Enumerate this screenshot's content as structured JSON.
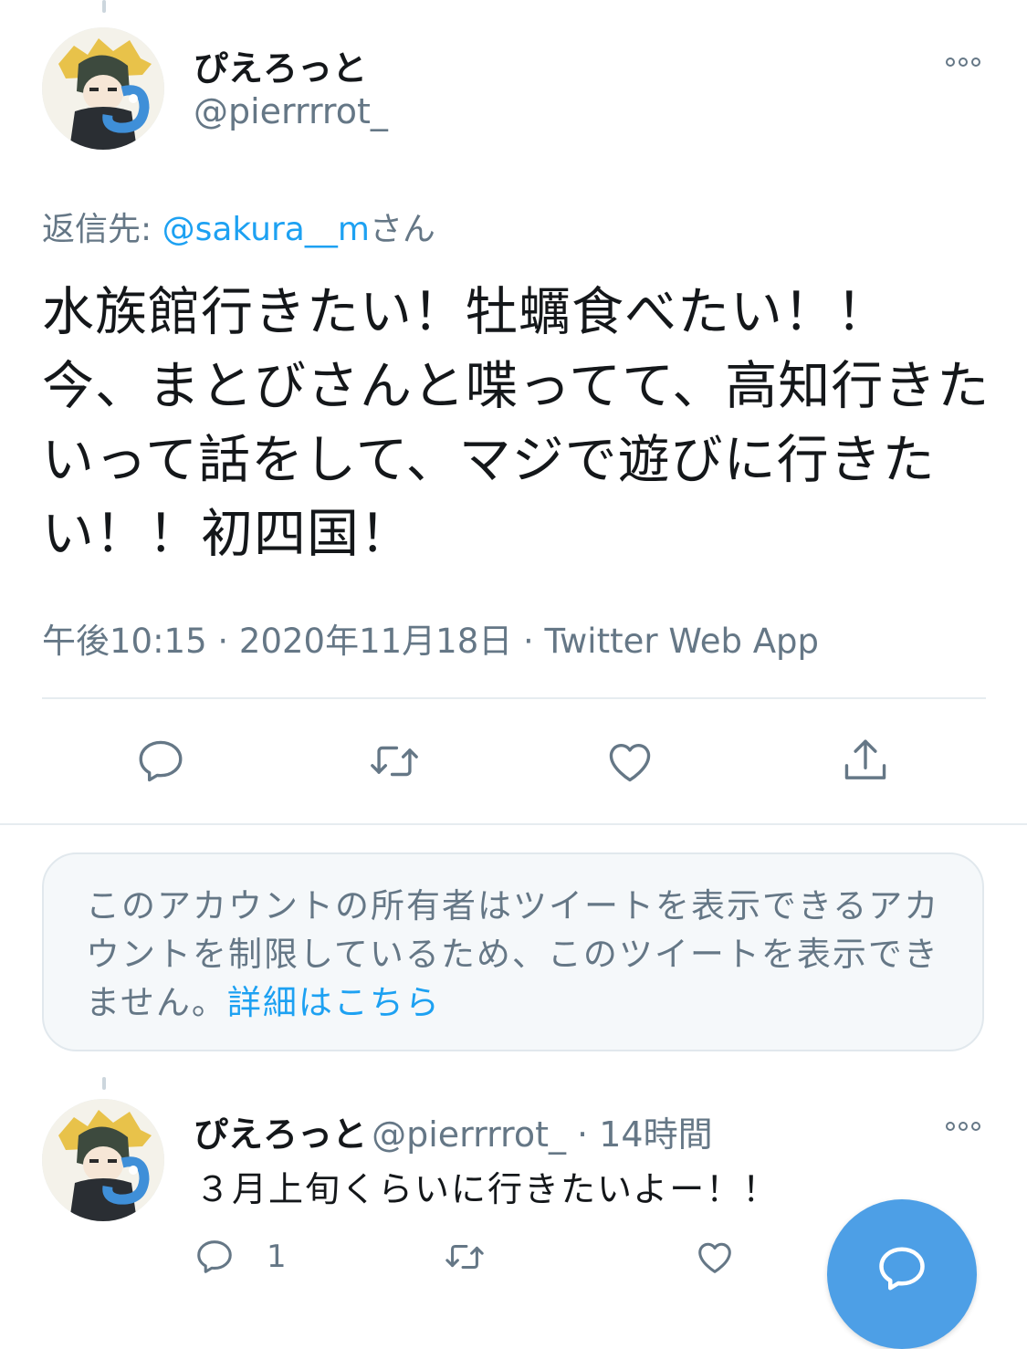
{
  "main_tweet": {
    "display_name": "ぴえろっと",
    "handle": "@pierrrrot_",
    "reply_label": "返信先: ",
    "reply_to_handle": "@sakura__m",
    "reply_suffix": "さん",
    "text": "水族館行きたい！牡蠣食べたい！！\n今、まとびさんと喋ってて、高知行きたいって話をして、マジで遊びに行きたい！！初四国！",
    "timestamp": "午後10:15 · 2020年11月18日",
    "separator": " · ",
    "source": "Twitter Web App",
    "actions": {
      "reply_icon": "reply-icon",
      "retweet_icon": "retweet-icon",
      "like_icon": "like-icon",
      "share_icon": "share-icon"
    }
  },
  "restricted_notice": {
    "text": "このアカウントの所有者はツイートを表示できるアカウントを制限しているため、このツイートを表示できません。",
    "link": "詳細はこちら"
  },
  "reply_tweet": {
    "display_name": "ぴえろっと",
    "handle": "@pierrrrot_",
    "time_separator": " · ",
    "time": "14時間",
    "text": "３月上旬くらいに行きたいよー！！",
    "reply_count": "1"
  },
  "colors": {
    "accent": "#1da1f2",
    "secondary_text": "#657786",
    "fab": "#4d9fe6"
  }
}
